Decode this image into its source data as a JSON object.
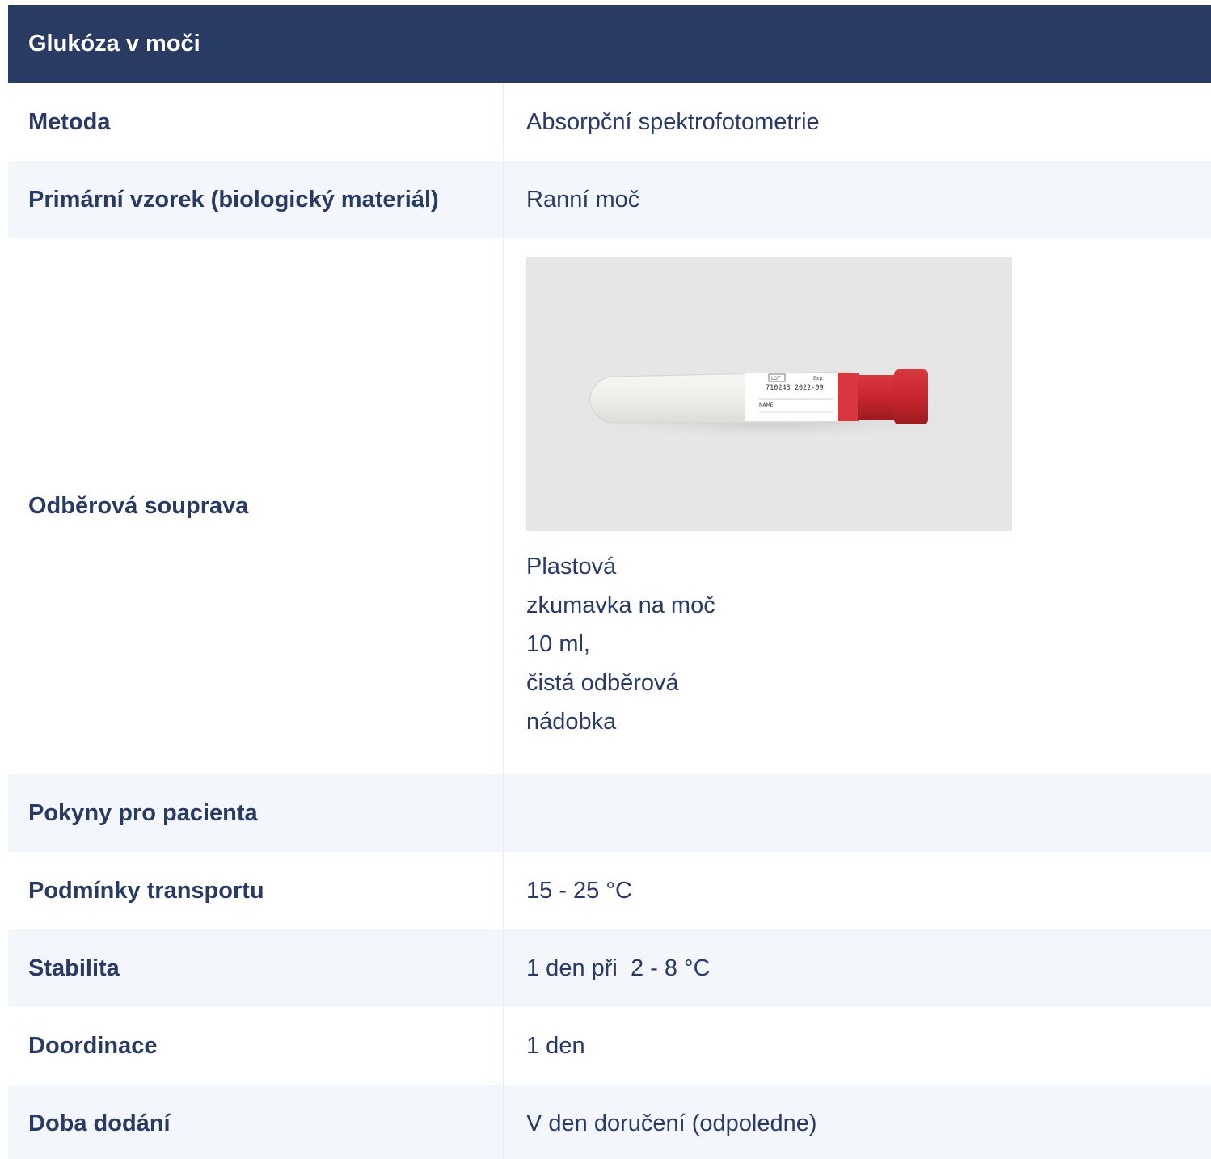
{
  "title": "Glukóza v moči",
  "rows": [
    {
      "label": "Metoda",
      "value": "Absorpční spektrofotometrie"
    },
    {
      "label": "Primární vzorek (biologický materiál)",
      "value": "Ranní moč"
    },
    {
      "label": "Odběrová souprava",
      "image_alt": "Plastová zkumavka na moč",
      "lines": [
        "Plastová",
        "zkumavka na moč",
        "10 ml,",
        "čistá odběrová",
        "nádobka"
      ]
    },
    {
      "label": "Pokyny pro pacienta",
      "value": ""
    },
    {
      "label": "Podmínky transportu",
      "value": "15 - 25 °C"
    },
    {
      "label": "Stabilita",
      "value": "1 den při  2 - 8 °C"
    },
    {
      "label": "Doordinace",
      "value": "1 den"
    },
    {
      "label": "Doba dodání",
      "value": "V den doručení (odpoledne)"
    }
  ],
  "tube_label": {
    "lot_box": "LOT",
    "exp_text": "Exp.",
    "code": "710243  2022-09",
    "name": "NAME"
  },
  "colors": {
    "header_bg": "#293a63",
    "alt_row_bg": "#f3f7fc",
    "text": "#2a3a66",
    "cap_red": "#c8262b"
  }
}
